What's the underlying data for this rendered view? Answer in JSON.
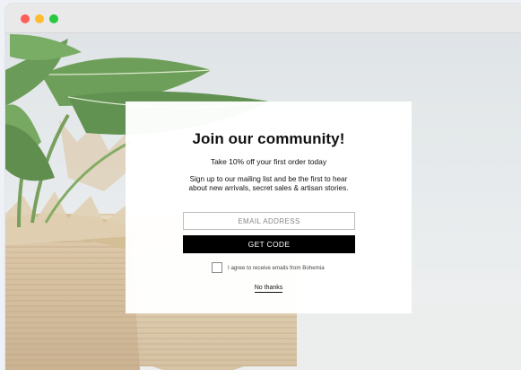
{
  "window": {
    "controls": [
      "close",
      "minimize",
      "maximize"
    ]
  },
  "popup": {
    "title": "Join our community!",
    "offer": "Take 10% off your first order today",
    "description": "Sign up to our mailing list and be the first to hear about new arrivals, secret sales & artisan stories.",
    "email_placeholder": "EMAIL ADDRESS",
    "email_value": "",
    "submit_label": "GET CODE",
    "consent_label": "I agree to receive emails from Bohemia",
    "consent_checked": false,
    "dismiss_label": "No thanks"
  },
  "colors": {
    "button_bg": "#000000",
    "modal_bg": "#ffffff",
    "close_dot": "#fe5f57",
    "minimize_dot": "#febc2e",
    "maximize_dot": "#28c840"
  }
}
